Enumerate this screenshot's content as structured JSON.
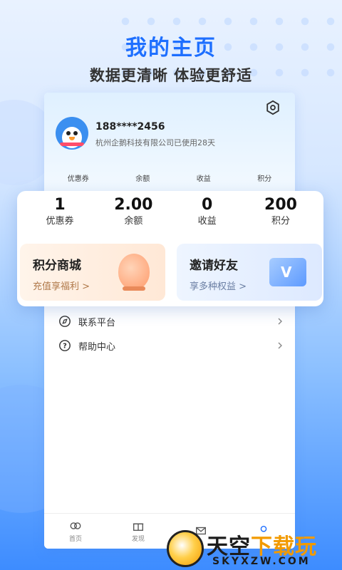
{
  "hero": {
    "title": "我的主页",
    "subtitle": "数据更清晰 体验更舒适"
  },
  "profile": {
    "phone": "188****2456",
    "company_usage": "杭州企鹅科技有限公司已使用28天"
  },
  "mini_stats": [
    "优惠券",
    "余额",
    "收益",
    "积分"
  ],
  "stats": [
    {
      "value": "1",
      "label": "优惠券"
    },
    {
      "value": "2.00",
      "label": "余额"
    },
    {
      "value": "0",
      "label": "收益"
    },
    {
      "value": "200",
      "label": "积分"
    }
  ],
  "promos": {
    "left": {
      "title": "积分商城",
      "subtitle": "充值享福利 >"
    },
    "right": {
      "title": "邀请好友",
      "subtitle": "享多种权益 >"
    }
  },
  "menu": [
    {
      "label": "联系平台",
      "icon": "compass-icon"
    },
    {
      "label": "帮助中心",
      "icon": "question-icon"
    }
  ],
  "tabs": [
    {
      "label": "首页",
      "icon": "home-icon"
    },
    {
      "label": "发现",
      "icon": "gift-icon"
    },
    {
      "label": "",
      "icon": "mail-icon"
    },
    {
      "label": "",
      "icon": "profile-icon"
    }
  ],
  "watermark": {
    "brand_a": "天空",
    "brand_b": "下载玩",
    "url": "SKYXZW.COM"
  },
  "colors": {
    "accent": "#1e6fff",
    "background_bottom": "#3d8cff",
    "promo_left": "#fff4ea",
    "promo_right": "#eef5ff"
  }
}
